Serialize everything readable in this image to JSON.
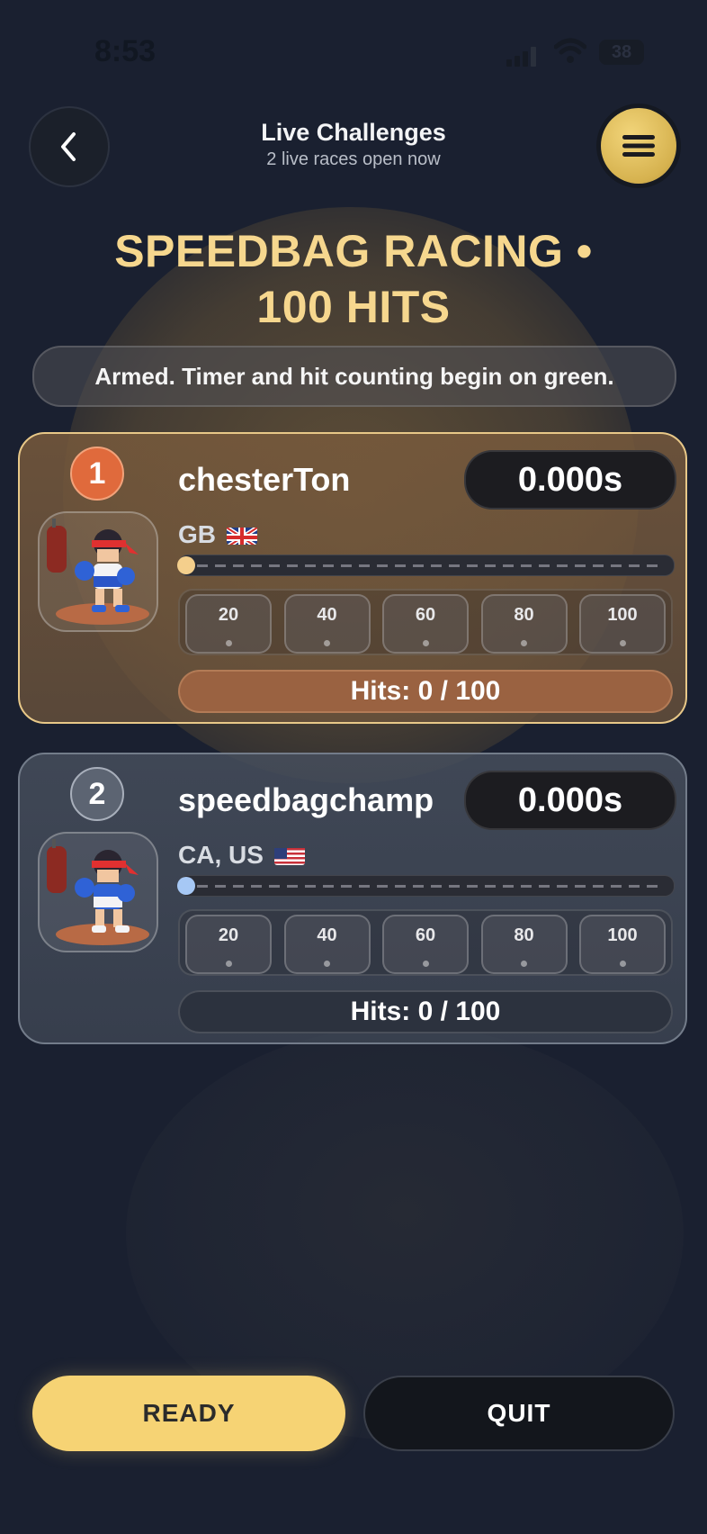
{
  "status_bar": {
    "time": "8:53",
    "battery": "38"
  },
  "header": {
    "title": "Live Challenges",
    "subtitle": "2 live races open now"
  },
  "race": {
    "title": "SPEEDBAG RACING • 100 HITS",
    "message": "Armed. Timer and hit counting begin on green."
  },
  "racers": [
    {
      "rank": "1",
      "name": "chesterTon",
      "time": "0.000s",
      "country": "GB",
      "flag_icon": "uk-flag-icon",
      "progress": 0,
      "milestones": [
        "20",
        "40",
        "60",
        "80",
        "100"
      ],
      "hits": "Hits: 0 / 100",
      "accent": "#e06a3c"
    },
    {
      "rank": "2",
      "name": "speedbagchamp",
      "time": "0.000s",
      "country": "CA, US",
      "flag_icon": "us-flag-icon",
      "progress": 0,
      "milestones": [
        "20",
        "40",
        "60",
        "80",
        "100"
      ],
      "hits": "Hits: 0 / 100",
      "accent": "#5c6472"
    }
  ],
  "actions": {
    "ready": "READY",
    "quit": "QUIT"
  },
  "colors": {
    "gold": "#f6d374",
    "title": "#f6d78e",
    "background": "#1a2030"
  }
}
